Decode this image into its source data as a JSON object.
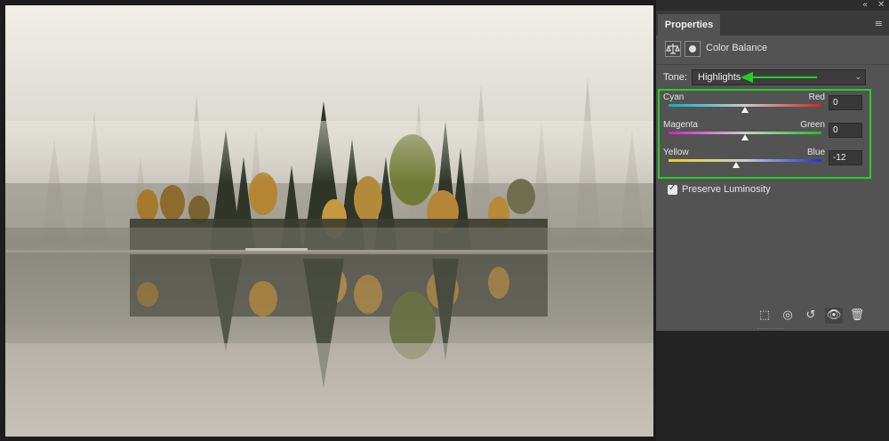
{
  "panel": {
    "tab_title": "Properties",
    "collapse_icon": "double-chevron-icon",
    "close_icon": "close-icon",
    "menu_icon": "panel-menu-icon",
    "adjustment": {
      "icon": "color-balance-icon",
      "mask_icon": "mask-icon",
      "title": "Color Balance"
    },
    "tone": {
      "label": "Tone:",
      "selected": "Highlights"
    },
    "sliders": [
      {
        "left": "Cyan",
        "right": "Red",
        "value": "0",
        "level": 0.5
      },
      {
        "left": "Magenta",
        "right": "Green",
        "value": "0",
        "level": 0.5
      },
      {
        "left": "Yellow",
        "right": "Blue",
        "value": "-12",
        "level": 0.44
      }
    ],
    "preserve_luminosity": {
      "label": "Preserve Luminosity",
      "checked": true
    },
    "footer_icons": [
      "clip-to-layer-icon",
      "view-previous-state-icon",
      "reset-icon",
      "visibility-icon",
      "trash-icon"
    ]
  },
  "colors": {
    "highlight_box": "#24d024",
    "annotation_arrow": "#24d024",
    "panel_bg": "#535353"
  }
}
